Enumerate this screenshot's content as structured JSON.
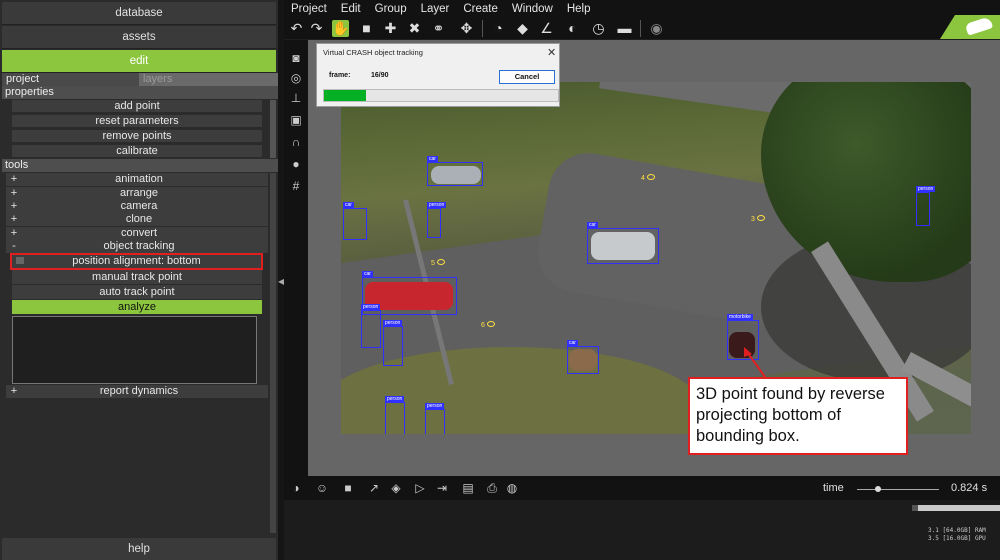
{
  "sidebar": {
    "database": "database",
    "assets": "assets",
    "edit": "edit",
    "tabs": {
      "project": "project",
      "layers": "layers"
    },
    "properties_header": "properties",
    "properties": [
      "add point",
      "reset parameters",
      "remove points",
      "calibrate"
    ],
    "tools_header": "tools",
    "tools": [
      {
        "sign": "+",
        "label": "animation"
      },
      {
        "sign": "+",
        "label": "arrange"
      },
      {
        "sign": "+",
        "label": "camera"
      },
      {
        "sign": "+",
        "label": "clone"
      },
      {
        "sign": "+",
        "label": "convert"
      },
      {
        "sign": "-",
        "label": "object tracking"
      }
    ],
    "tracking": [
      "position alignment: bottom",
      "manual track point",
      "auto track point",
      "analyze"
    ],
    "report": {
      "sign": "+",
      "label": "report dynamics"
    },
    "help": "help"
  },
  "menubar": [
    "Project",
    "Edit",
    "Group",
    "Layer",
    "Create",
    "Window",
    "Help"
  ],
  "dialog": {
    "title": "Virtual CRASH object tracking",
    "frame_label": "frame:",
    "frame_value": "16/90",
    "cancel": "Cancel",
    "progress": 0.18
  },
  "detections": [
    "car",
    "car",
    "car",
    "car",
    "person",
    "person",
    "person",
    "person",
    "person",
    "person",
    "motorbike",
    "car"
  ],
  "markers": [
    "4",
    "3",
    "5",
    "6"
  ],
  "annotation": "3D point found by reverse projecting bottom of bounding box.",
  "bottom": {
    "time_label": "time",
    "time_value": "0.824 s",
    "ram": "3.1 [64.0GB] RAM",
    "gpu": "3.5 [16.0GB] GPU"
  },
  "colors": {
    "accent": "#8cc63f",
    "highlight": "#e02020",
    "bbox": "#3030ff",
    "progress": "#06b025"
  }
}
